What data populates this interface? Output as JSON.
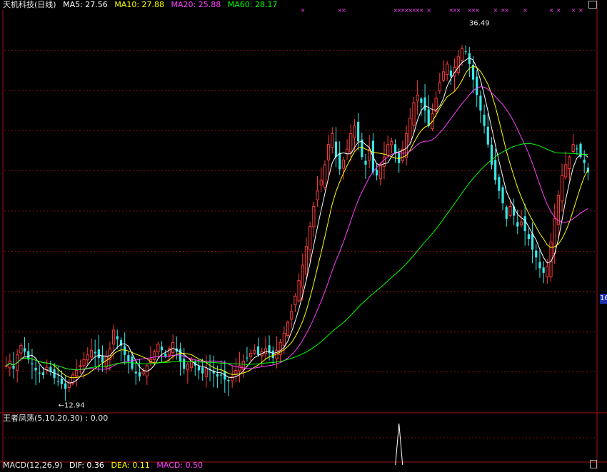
{
  "main_header": {
    "stock": "天机科技(日线)",
    "ma5": "MA5: 27.56",
    "ma10": "MA10: 27.88",
    "ma20": "MA20: 25.88",
    "ma60": "MA60: 28.17"
  },
  "indicator_header": {
    "text": "王者凤荡(5,10,20,30) : 0.00"
  },
  "macd_header": {
    "macd": "MACD(12,26,9)",
    "dif": "DIF: 0.36",
    "dea": "DEA: 0.11",
    "macd_value": "MACD: 0.50"
  },
  "right_axis_tag": "16",
  "colors": {
    "background": "#000000",
    "up_candle": "#ff3b3b",
    "down_candle": "#39e6e6",
    "ma5": "#ffffff",
    "ma10": "#ffff00",
    "ma20": "#ff40ff",
    "ma60": "#00ff00",
    "grid": "#a01515",
    "signal_marker": "#ff40ff"
  },
  "chart_data": {
    "type": "candlestick",
    "price_range": [
      11.5,
      37.5
    ],
    "annotations": {
      "high_label": "36.49",
      "low_label": "12.94"
    },
    "closes": [
      14.5,
      14.8,
      14.3,
      15.2,
      15.8,
      15.4,
      14.9,
      14.6,
      14.2,
      14.0,
      13.9,
      14.4,
      14.1,
      13.7,
      13.5,
      13.3,
      13.0,
      13.4,
      13.9,
      14.2,
      14.5,
      14.9,
      15.2,
      15.5,
      15.3,
      15.0,
      14.7,
      15.1,
      15.6,
      16.8,
      16.2,
      15.8,
      15.2,
      14.8,
      14.3,
      14.0,
      13.8,
      14.1,
      14.5,
      14.9,
      15.4,
      15.9,
      15.5,
      15.1,
      15.6,
      16.0,
      15.4,
      14.8,
      14.3,
      14.6,
      14.9,
      14.5,
      14.2,
      14.0,
      14.3,
      14.2,
      14.0,
      13.8,
      13.9,
      13.6,
      13.5,
      13.8,
      14.2,
      14.5,
      14.8,
      15.0,
      15.3,
      15.5,
      15.2,
      15.4,
      15.6,
      15.3,
      15.0,
      15.5,
      16.0,
      16.6,
      17.3,
      18.0,
      19.0,
      20.0,
      21.0,
      22.2,
      23.5,
      24.8,
      25.8,
      26.5,
      27.5,
      28.8,
      29.5,
      28.0,
      27.2,
      27.8,
      28.5,
      29.5,
      30.0,
      29.0,
      28.0,
      27.5,
      28.5,
      27.0,
      26.8,
      27.5,
      28.0,
      28.8,
      29.0,
      28.2,
      27.6,
      28.5,
      29.5,
      30.5,
      31.5,
      32.0,
      31.5,
      31.0,
      30.0,
      30.8,
      31.8,
      32.8,
      33.5,
      34.0,
      33.2,
      33.8,
      34.5,
      35.0,
      34.8,
      34.0,
      33.0,
      32.0,
      31.0,
      30.0,
      28.8,
      27.5,
      26.5,
      25.8,
      25.0,
      24.0,
      24.8,
      24.2,
      23.5,
      23.8,
      23.2,
      22.7,
      22.0,
      21.5,
      20.8,
      20.5,
      20.9,
      22.5,
      24.0,
      25.5,
      26.8,
      27.5,
      28.0,
      28.8,
      28.5,
      28.0,
      27.6,
      27.0
    ],
    "signal_marker_indices": [
      80,
      90,
      91,
      105,
      106,
      107,
      108,
      109,
      110,
      111,
      112,
      114,
      120,
      121,
      122,
      125,
      126,
      127,
      132,
      134,
      135,
      140,
      147,
      149,
      153,
      155
    ],
    "indicator": {
      "name": "王者凤荡(5,10,20,30)",
      "value": 0.0,
      "spike_index": 106,
      "spike_value": 1.0
    }
  }
}
